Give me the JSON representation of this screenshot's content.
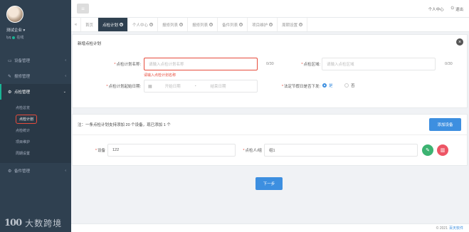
{
  "profile": {
    "name": "测试企业 ▾",
    "user": "lyq",
    "status": "在线"
  },
  "sidebar": {
    "items": [
      {
        "label": "设备管理"
      },
      {
        "label": "报修管理"
      },
      {
        "label": "点检管理"
      },
      {
        "label": "备件管理"
      }
    ],
    "submenu": [
      {
        "label": "点检总览"
      },
      {
        "label": "点检计划"
      },
      {
        "label": "点检统计"
      },
      {
        "label": "项目维护"
      },
      {
        "label": "周期设置"
      }
    ]
  },
  "brand": {
    "logo": "100",
    "text": "大数跨境"
  },
  "header": {
    "personal": "个人中心",
    "logout": "退出"
  },
  "tabs": [
    {
      "label": "首页"
    },
    {
      "label": "点检计划"
    },
    {
      "label": "个人中心"
    },
    {
      "label": "报修列表"
    },
    {
      "label": "报修列表"
    },
    {
      "label": "备件列表"
    },
    {
      "label": "项目维护"
    },
    {
      "label": "周期设置"
    }
  ],
  "form": {
    "title": "新增点检计划",
    "plan_name_label": "点检计划名称:",
    "plan_name_placeholder": "请输入点检计划名称",
    "plan_name_error": "请输入点检计划名称",
    "plan_name_count": "0/30",
    "area_label": "点检区域:",
    "area_placeholder": "请输入点检区域",
    "area_count": "0/30",
    "date_label": "点检计划起始日期:",
    "start_placeholder": "开始日期",
    "date_sep": "-",
    "end_placeholder": "结束日期",
    "holiday_label": "法定节假日是否下发:",
    "yes": "是",
    "no": "否"
  },
  "device": {
    "note": "注：一条点检计划支持添加 20 个设备，现已添加 1 个",
    "add_button": "添加设备",
    "device_label": "设备",
    "device_value": "122",
    "group_label": "点检人/组",
    "group_value": "组1"
  },
  "next_button": "下一步",
  "footer": {
    "copyright": "© 2021",
    "company": "百天软件"
  },
  "colors": {
    "sidebar": "#2f4050",
    "primary": "#3d8fe0",
    "error": "#e74c3c",
    "success": "#3cb371",
    "danger": "#ed5565"
  }
}
